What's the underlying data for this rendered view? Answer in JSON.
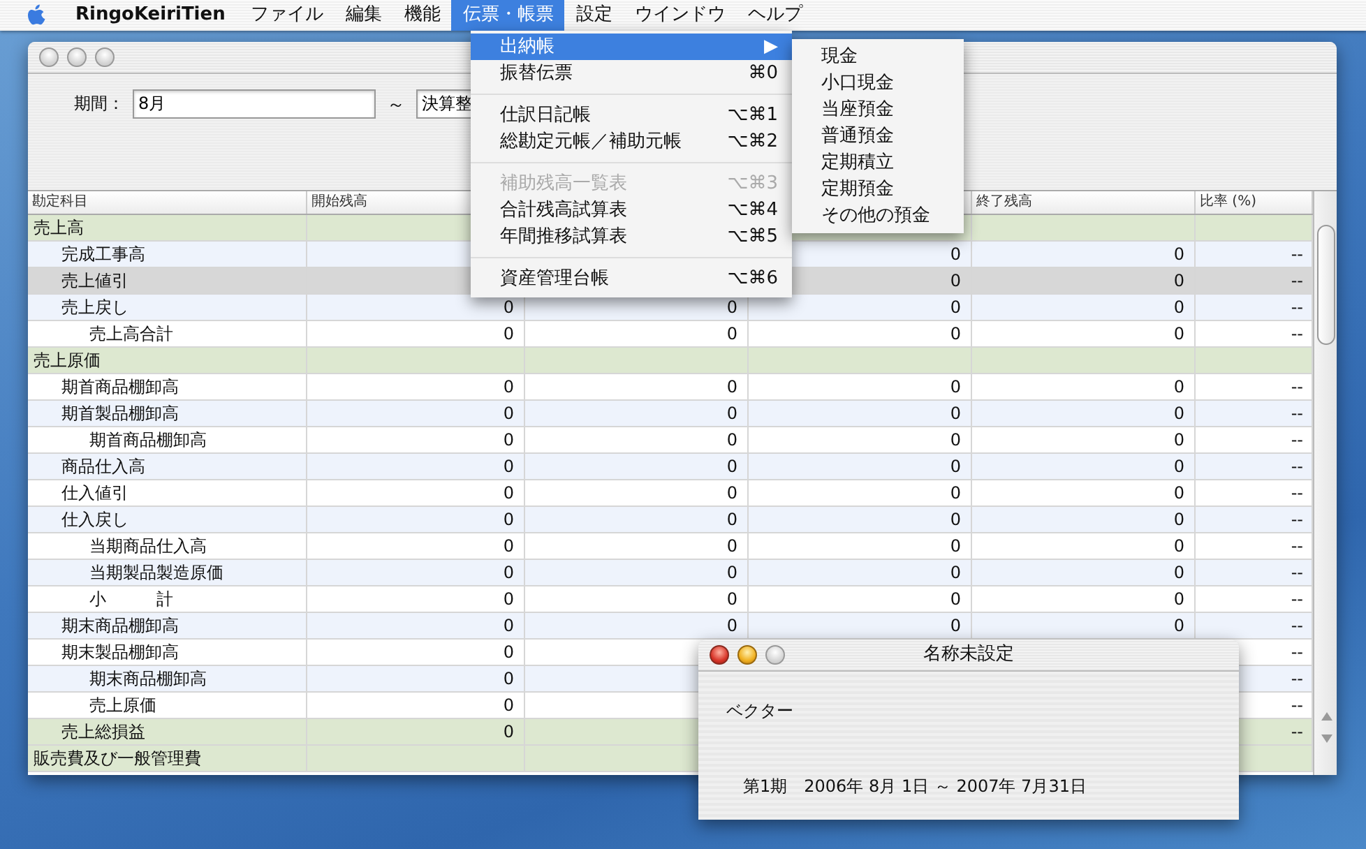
{
  "menu_bar": {
    "items": [
      {
        "label": "RingoKeiriTien",
        "kind": "app",
        "selected": false
      },
      {
        "label": "ファイル",
        "kind": "menu",
        "selected": false
      },
      {
        "label": "編集",
        "kind": "menu",
        "selected": false
      },
      {
        "label": "機能",
        "kind": "menu",
        "selected": false
      },
      {
        "label": "伝票・帳票",
        "kind": "menu",
        "selected": true
      },
      {
        "label": "設定",
        "kind": "menu",
        "selected": false
      },
      {
        "label": "ウインドウ",
        "kind": "menu",
        "selected": false
      },
      {
        "label": "ヘルプ",
        "kind": "menu",
        "selected": false
      }
    ]
  },
  "menu": {
    "items": [
      {
        "kind": "item",
        "label": "出納帳",
        "shortcut": "▶",
        "selected": true,
        "disabled": false
      },
      {
        "kind": "item",
        "label": "振替伝票",
        "shortcut": "⌘0",
        "selected": false,
        "disabled": false
      },
      {
        "kind": "separator"
      },
      {
        "kind": "item",
        "label": "仕訳日記帳",
        "shortcut": "⌥⌘1",
        "selected": false,
        "disabled": false
      },
      {
        "kind": "item",
        "label": "総勘定元帳／補助元帳",
        "shortcut": "⌥⌘2",
        "selected": false,
        "disabled": false
      },
      {
        "kind": "separator"
      },
      {
        "kind": "item",
        "label": "補助残高一覧表",
        "shortcut": "⌥⌘3",
        "selected": false,
        "disabled": true
      },
      {
        "kind": "item",
        "label": "合計残高試算表",
        "shortcut": "⌥⌘4",
        "selected": false,
        "disabled": false
      },
      {
        "kind": "item",
        "label": "年間推移試算表",
        "shortcut": "⌥⌘5",
        "selected": false,
        "disabled": false
      },
      {
        "kind": "separator"
      },
      {
        "kind": "item",
        "label": "資産管理台帳",
        "shortcut": "⌥⌘6",
        "selected": false,
        "disabled": false
      }
    ]
  },
  "submenu": {
    "items": [
      {
        "label": "現金",
        "selected": false
      },
      {
        "label": "小口現金",
        "selected": false
      },
      {
        "label": "当座預金",
        "selected": false
      },
      {
        "label": "普通預金",
        "selected": false
      },
      {
        "label": "定期積立",
        "selected": false
      },
      {
        "label": "定期預金",
        "selected": false
      },
      {
        "label": "その他の預金",
        "selected": false
      }
    ]
  },
  "main_window": {
    "active": false,
    "period_label": "期間：",
    "period_from": "8月",
    "range_sign": "～",
    "period_to": "決算整",
    "table": {
      "columns": {
        "account": "勘定科目",
        "opening": "開始残高",
        "closing": "終了残高",
        "ratio": "比率 (%)"
      },
      "rows": [
        {
          "kind": "heading",
          "label": "売上高",
          "selected": false,
          "children": [
            {
              "kind": "item",
              "label": "完成工事高",
              "selected": false,
              "values": {
                "column_4": "0",
                "closing": "0",
                "ratio": "--"
              }
            },
            {
              "kind": "item",
              "label": "売上値引",
              "selected": true,
              "values": {
                "column_4": "0",
                "closing": "0",
                "ratio": "--"
              }
            },
            {
              "kind": "item",
              "label": "売上戻し",
              "selected": false,
              "values": {
                "opening": "0",
                "column_3": "0",
                "column_4": "0",
                "closing": "0",
                "ratio": "--"
              },
              "children": [
                {
                  "kind": "item",
                  "label": "売上高合計",
                  "selected": false,
                  "values": {
                    "opening": "0",
                    "column_3": "0",
                    "column_4": "0",
                    "closing": "0",
                    "ratio": "--"
                  }
                }
              ]
            }
          ]
        },
        {
          "kind": "heading",
          "label": "売上原価",
          "selected": false,
          "children": [
            {
              "kind": "item",
              "label": "期首商品棚卸高",
              "selected": false,
              "values": {
                "opening": "0",
                "column_3": "0",
                "column_4": "0",
                "closing": "0",
                "ratio": "--"
              }
            },
            {
              "kind": "item",
              "label": "期首製品棚卸高",
              "selected": false,
              "values": {
                "opening": "0",
                "column_3": "0",
                "column_4": "0",
                "closing": "0",
                "ratio": "--"
              },
              "children": [
                {
                  "kind": "item",
                  "label": "期首商品棚卸高",
                  "selected": false,
                  "values": {
                    "opening": "0",
                    "column_3": "0",
                    "column_4": "0",
                    "closing": "0",
                    "ratio": "--"
                  }
                }
              ]
            },
            {
              "kind": "item",
              "label": "商品仕入高",
              "selected": false,
              "values": {
                "opening": "0",
                "column_3": "0",
                "column_4": "0",
                "closing": "0",
                "ratio": "--"
              }
            },
            {
              "kind": "item",
              "label": "仕入値引",
              "selected": false,
              "values": {
                "opening": "0",
                "column_3": "0",
                "column_4": "0",
                "closing": "0",
                "ratio": "--"
              }
            },
            {
              "kind": "item",
              "label": "仕入戻し",
              "selected": false,
              "values": {
                "opening": "0",
                "column_3": "0",
                "column_4": "0",
                "closing": "0",
                "ratio": "--"
              },
              "children": [
                {
                  "kind": "item",
                  "label": "当期商品仕入高",
                  "selected": false,
                  "values": {
                    "opening": "0",
                    "column_3": "0",
                    "column_4": "0",
                    "closing": "0",
                    "ratio": "--"
                  }
                },
                {
                  "kind": "item",
                  "label": "当期製品製造原価",
                  "selected": false,
                  "values": {
                    "opening": "0",
                    "column_3": "0",
                    "column_4": "0",
                    "closing": "0",
                    "ratio": "--"
                  }
                },
                {
                  "kind": "item",
                  "label": "小　　　計",
                  "selected": false,
                  "values": {
                    "opening": "0",
                    "column_3": "0",
                    "column_4": "0",
                    "closing": "0",
                    "ratio": "--"
                  }
                }
              ]
            },
            {
              "kind": "item",
              "label": "期末商品棚卸高",
              "selected": false,
              "values": {
                "opening": "0",
                "column_3": "0",
                "column_4": "0",
                "closing": "0",
                "ratio": "--"
              }
            },
            {
              "kind": "item",
              "label": "期末製品棚卸高",
              "selected": false,
              "values": {
                "opening": "0",
                "ratio": "--"
              },
              "children": [
                {
                  "kind": "item",
                  "label": "期末商品棚卸高",
                  "selected": false,
                  "values": {
                    "opening": "0",
                    "ratio": "--"
                  }
                },
                {
                  "kind": "item",
                  "label": "売上原価",
                  "selected": false,
                  "values": {
                    "opening": "0",
                    "ratio": "--"
                  }
                }
              ]
            },
            {
              "kind": "total",
              "label": "売上総損益",
              "selected": false,
              "values": {
                "opening": "0",
                "ratio": "--"
              }
            }
          ]
        },
        {
          "kind": "heading",
          "label": "販売費及び一般管理費",
          "selected": false
        }
      ]
    }
  },
  "info_window": {
    "active": true,
    "title": "名称未設定",
    "company": "ベクター",
    "period": "第1期　2006年 8月 1日 ～ 2007年 7月31日"
  }
}
